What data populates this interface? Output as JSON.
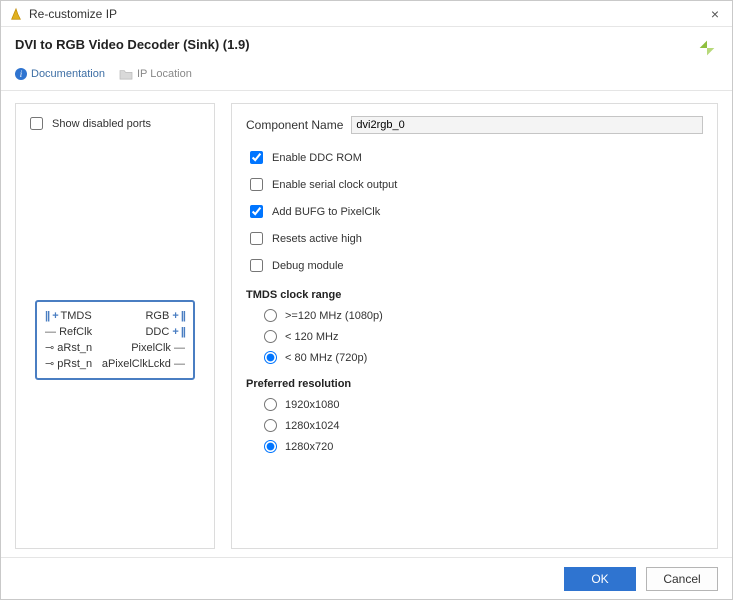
{
  "titlebar": {
    "title": "Re-customize IP",
    "close": "×"
  },
  "header": {
    "ip_title": "DVI to RGB Video Decoder (Sink) (1.9)"
  },
  "links": {
    "documentation": "Documentation",
    "ip_location": "IP Location"
  },
  "left": {
    "show_disabled_ports": "Show disabled ports",
    "ports": {
      "l0": "TMDS",
      "r0": "RGB",
      "l1": "RefClk",
      "r1": "DDC",
      "l2": "aRst_n",
      "r2": "PixelClk",
      "l3": "pRst_n",
      "r3": "aPixelClkLckd"
    }
  },
  "cfg": {
    "component_name_label": "Component Name",
    "component_name_value": "dvi2rgb_0",
    "opts": {
      "enable_ddc_rom": "Enable DDC ROM",
      "enable_serial_clock": "Enable serial clock output",
      "add_bufg": "Add BUFG to PixelClk",
      "resets_active_high": "Resets active high",
      "debug_module": "Debug module"
    },
    "tmds_header": "TMDS clock range",
    "tmds": {
      "o0": ">=120 MHz (1080p)",
      "o1": "< 120 MHz",
      "o2": "< 80 MHz (720p)"
    },
    "resolution_header": "Preferred resolution",
    "resolution": {
      "o0": "1920x1080",
      "o1": "1280x1024",
      "o2": "1280x720"
    }
  },
  "footer": {
    "ok": "OK",
    "cancel": "Cancel"
  }
}
